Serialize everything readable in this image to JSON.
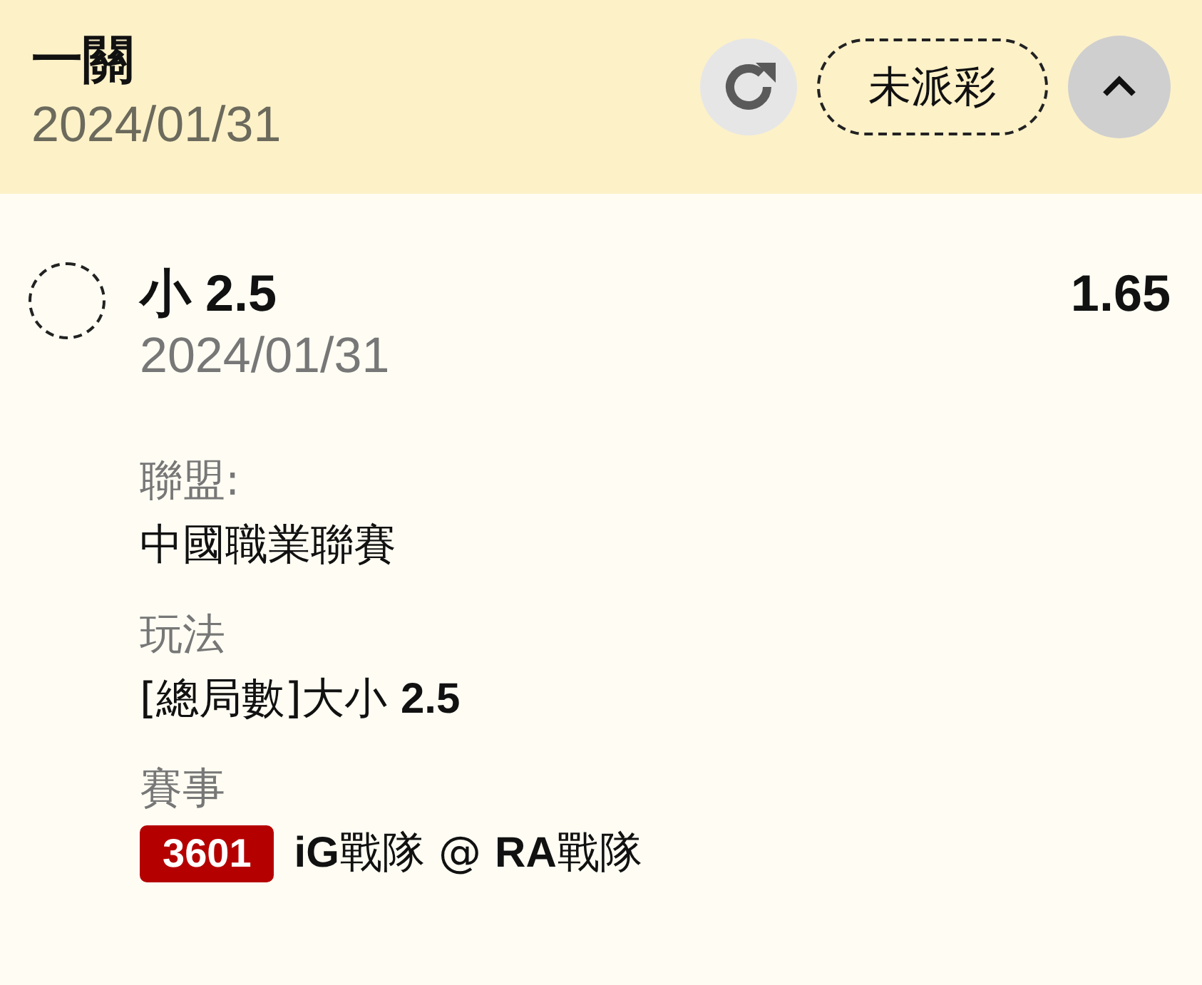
{
  "header": {
    "title": "一關",
    "date": "2024/01/31",
    "status": "未派彩",
    "expanded": true
  },
  "selection": {
    "name": "小 2.5",
    "date": "2024/01/31",
    "odds": "1.65",
    "selected": false
  },
  "details": [
    {
      "label": "聯盟:",
      "value": "中國職業聯賽"
    },
    {
      "label": "玩法",
      "value": "[總局數]大小 **2.5**"
    },
    {
      "label": "賽事",
      "badge": "3601",
      "value": "**iG**戰隊 @ **RA**戰隊"
    }
  ]
}
